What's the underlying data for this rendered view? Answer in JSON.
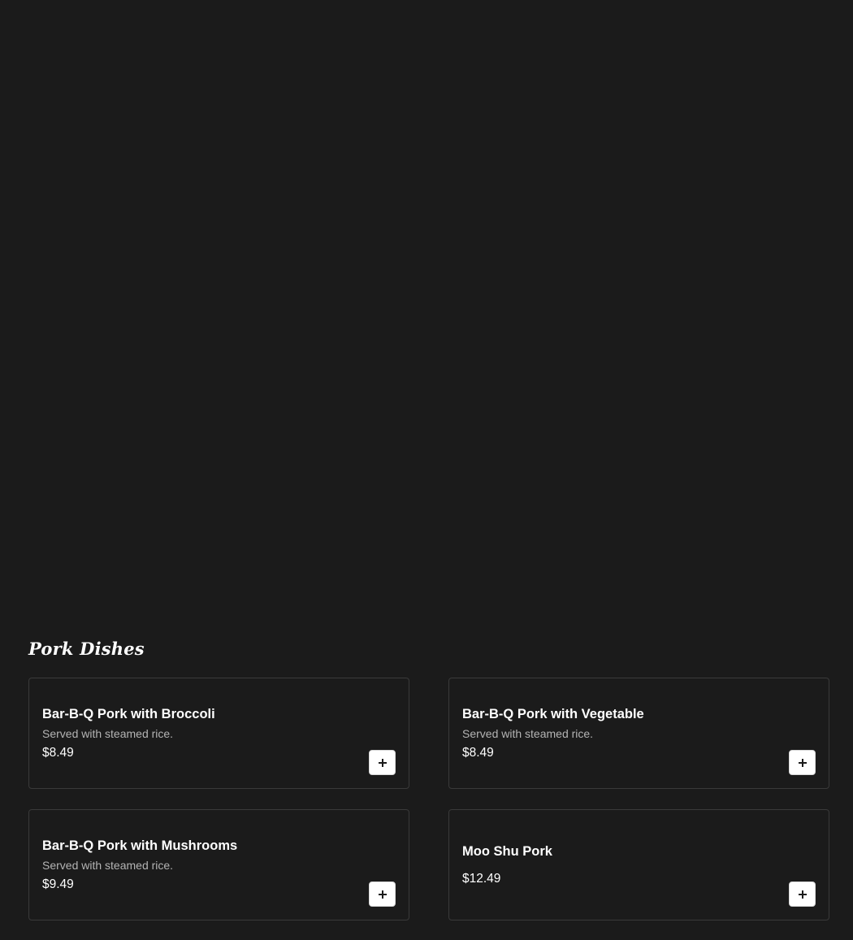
{
  "section": {
    "title": "Pork Dishes"
  },
  "items": [
    {
      "name": "Bar-B-Q Pork with Broccoli",
      "description": "Served with steamed rice.",
      "price": "$8.49"
    },
    {
      "name": "Bar-B-Q Pork with Vegetable",
      "description": "Served with steamed rice.",
      "price": "$8.49"
    },
    {
      "name": "Bar-B-Q Pork with Mushrooms",
      "description": "Served with steamed rice.",
      "price": "$9.49"
    },
    {
      "name": "Moo Shu Pork",
      "description": "",
      "price": "$12.49"
    }
  ],
  "icons": {
    "add": "plus-icon"
  },
  "colors": {
    "background": "#1b1b1b",
    "card_border": "#3a3a3a",
    "text_primary": "#ffffff",
    "text_secondary": "#b4b4b4",
    "button_bg": "#ffffff"
  }
}
